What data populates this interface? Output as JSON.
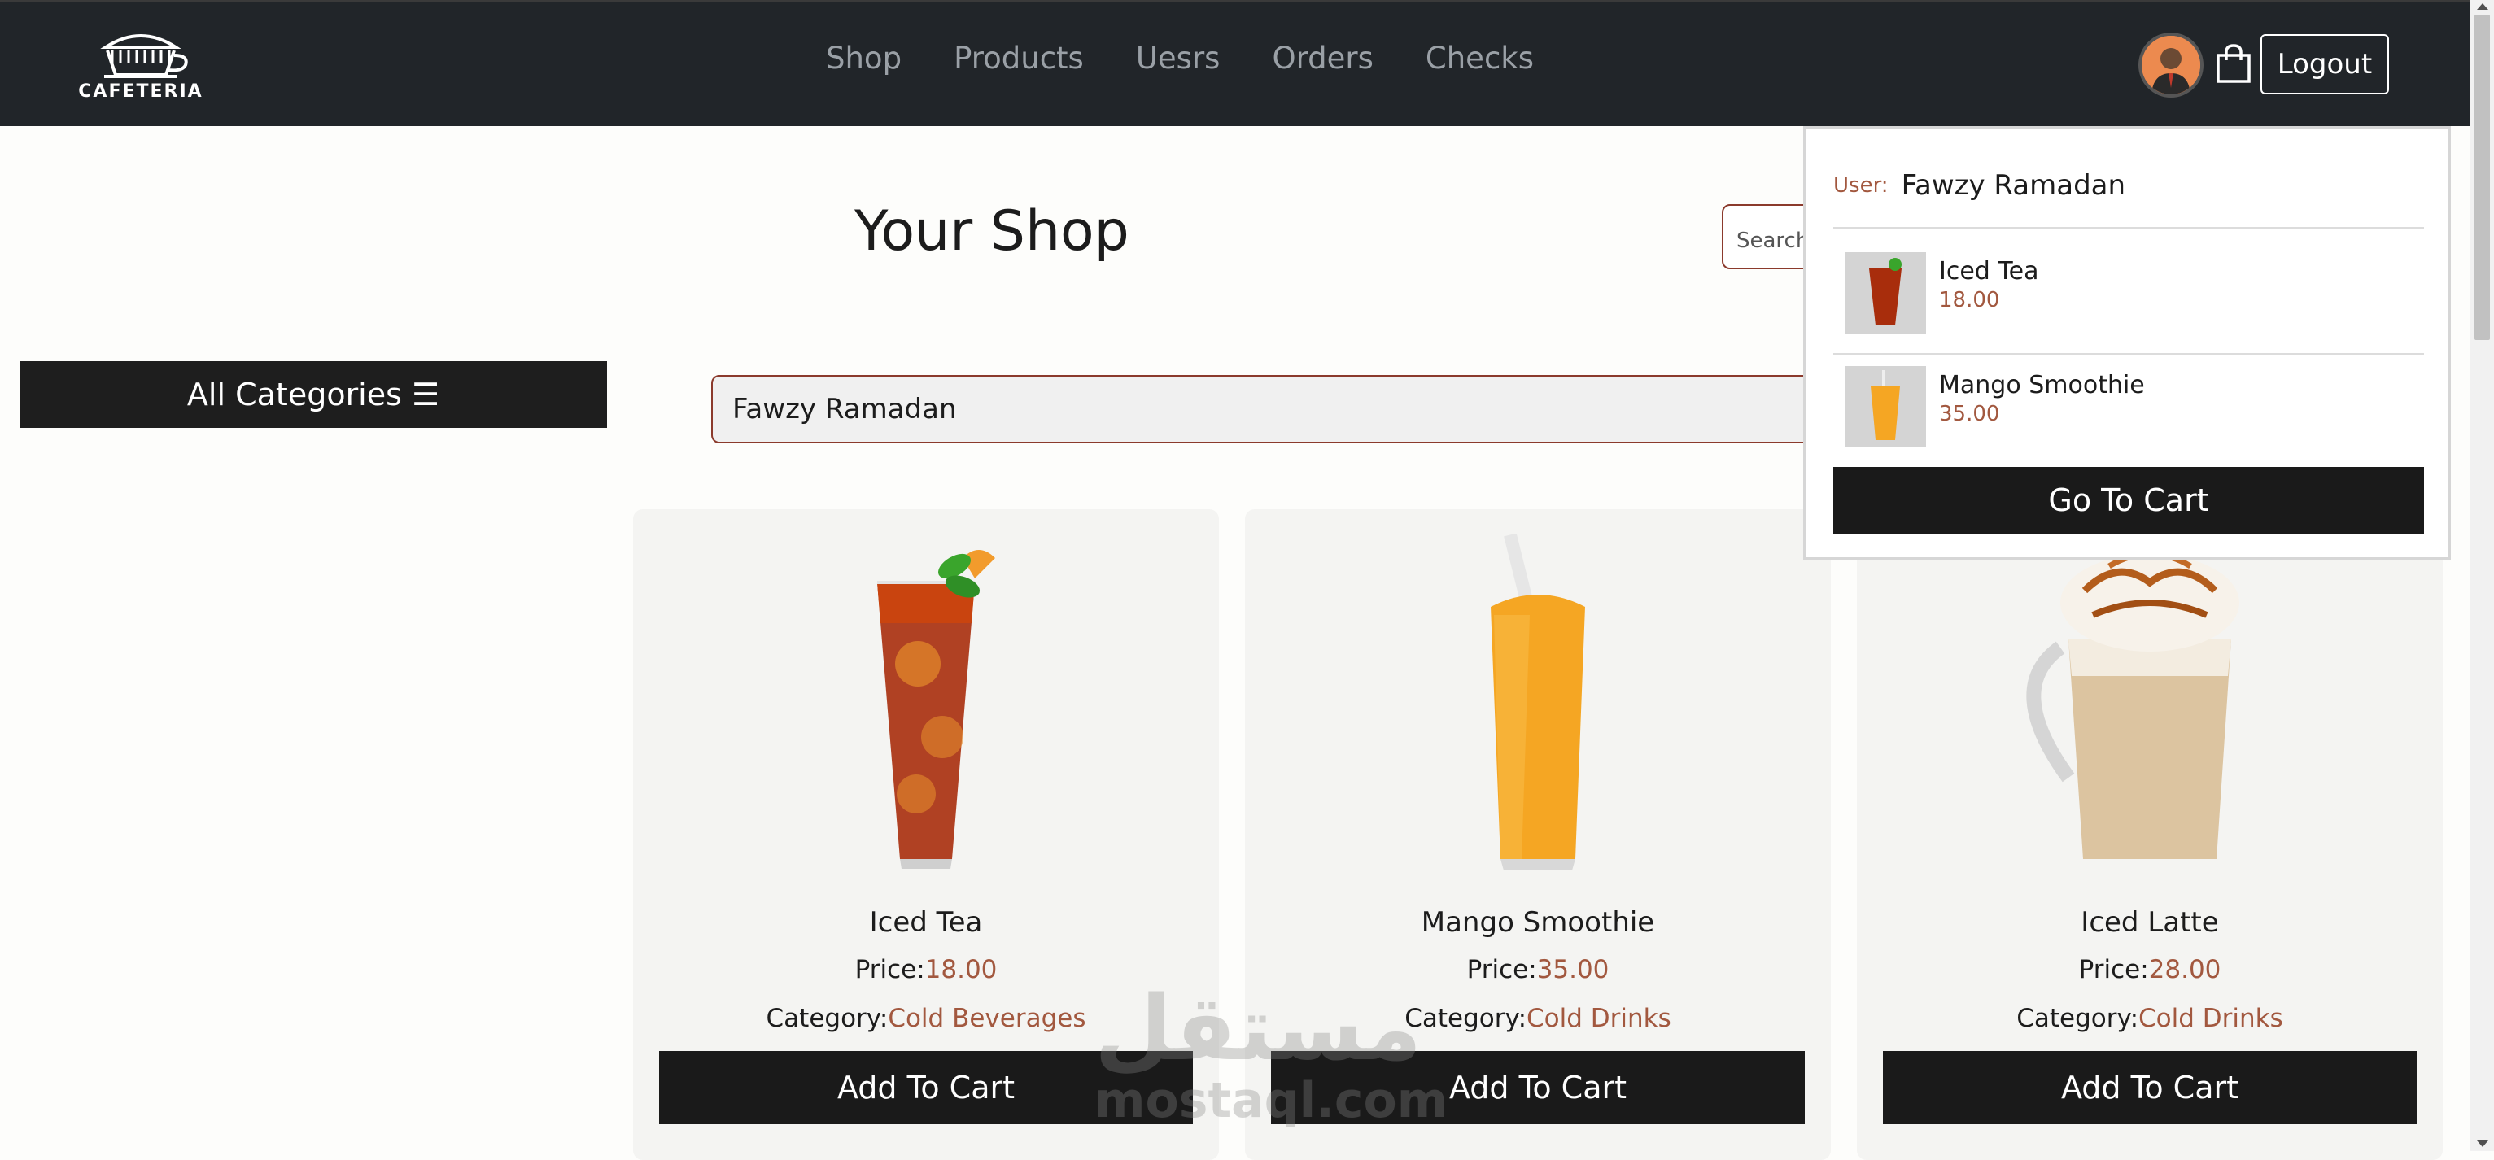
{
  "brand": {
    "logo_text": "CAFETERIA"
  },
  "nav": {
    "links": [
      "Shop",
      "Products",
      "Uesrs",
      "Orders",
      "Checks"
    ],
    "logout_label": "Logout"
  },
  "main": {
    "title": "Your Shop",
    "search_placeholder": "Search",
    "categories_label": "All Categories ☰",
    "user_field_value": "Fawzy Ramadan"
  },
  "products": [
    {
      "name": "Iced Tea",
      "price_label": "Price:",
      "price": "18.00",
      "category_label": "Category:",
      "category": "Cold Beverages",
      "button": "Add To Cart"
    },
    {
      "name": "Mango Smoothie",
      "price_label": "Price:",
      "price": "35.00",
      "category_label": "Category:",
      "category": "Cold Drinks",
      "button": "Add To Cart"
    },
    {
      "name": "Iced Latte",
      "price_label": "Price:",
      "price": "28.00",
      "category_label": "Category:",
      "category": "Cold Drinks",
      "button": "Add To Cart"
    }
  ],
  "cart": {
    "user_label": "User:",
    "user_name": "Fawzy Ramadan",
    "items": [
      {
        "name": "Iced Tea",
        "price": "18.00"
      },
      {
        "name": "Mango Smoothie",
        "price": "35.00"
      }
    ],
    "go_to_cart_label": "Go To Cart"
  },
  "watermark": {
    "arabic": "مستقل",
    "latin": "mostaql.com"
  },
  "icons": {
    "logo": "cafe-cart-logo-icon",
    "avatar": "user-avatar",
    "bag": "shopping-bag-icon"
  },
  "colors": {
    "navbar": "#212529",
    "accent": "#a2583f",
    "button": "#1a1a1a",
    "card": "#f4f4f2"
  }
}
